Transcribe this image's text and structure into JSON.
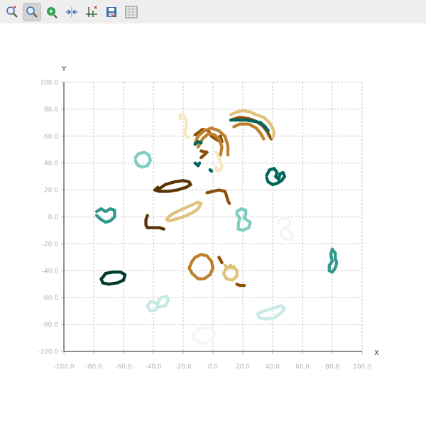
{
  "toolbar": {
    "tools": [
      {
        "icon": "zoom-select-icon",
        "active": false
      },
      {
        "icon": "zoom-icon",
        "active": true
      },
      {
        "icon": "pan-icon",
        "active": false
      },
      {
        "icon": "reset-zoom-icon",
        "active": false
      },
      {
        "icon": "axis-settings-icon",
        "active": false
      },
      {
        "icon": "save-icon",
        "active": false
      },
      {
        "icon": "data-table-icon",
        "active": false
      }
    ]
  },
  "chart_data": {
    "type": "scatter",
    "title": "",
    "xlabel": "X",
    "ylabel": "Y",
    "xlim": [
      -100,
      100
    ],
    "ylim": [
      -100,
      100
    ],
    "grid": true,
    "xticks": [
      "-100.0",
      "-80.0",
      "-60.0",
      "-40.0",
      "-20.0",
      "0.0",
      "20.0",
      "40.0",
      "60.0",
      "80.0",
      "100.0"
    ],
    "yticks": [
      "-100.0",
      "-80.0",
      "-60.0",
      "-40.0",
      "-20.0",
      "0.0",
      "20.0",
      "40.0",
      "60.0",
      "80.0",
      "100.0"
    ],
    "series": [
      {
        "color": "#5b3505",
        "points": [
          [
            -36,
            21
          ],
          [
            -32,
            24
          ],
          [
            -26,
            26
          ],
          [
            -20,
            27
          ],
          [
            -16,
            26
          ],
          [
            -15,
            24
          ],
          [
            -18,
            22
          ],
          [
            -24,
            20
          ],
          [
            -30,
            19
          ],
          [
            -36,
            19
          ],
          [
            -39,
            20
          ],
          [
            -37,
            22
          ]
        ]
      },
      {
        "color": "#5b3505",
        "points": [
          [
            -44,
            1
          ],
          [
            -45,
            -2
          ],
          [
            -45,
            -6
          ],
          [
            -44,
            -8
          ],
          [
            -40,
            -8
          ],
          [
            -36,
            -8
          ],
          [
            -33,
            -9
          ]
        ]
      },
      {
        "color": "#8c510a",
        "points": [
          [
            -4,
            18
          ],
          [
            0,
            19
          ],
          [
            4,
            20
          ],
          [
            8,
            19
          ],
          [
            9,
            16
          ],
          [
            10,
            12
          ],
          [
            11,
            10
          ]
        ]
      },
      {
        "color": "#8c510a",
        "points": [
          [
            -12,
            61
          ],
          [
            -7,
            65
          ],
          [
            -3,
            64
          ],
          [
            -1,
            60
          ],
          [
            3,
            57
          ],
          [
            6,
            56
          ],
          [
            5,
            60
          ],
          [
            2,
            58
          ]
        ]
      },
      {
        "color": "#8c510a",
        "points": [
          [
            12,
            72
          ],
          [
            18,
            74
          ],
          [
            24,
            73
          ],
          [
            29,
            71
          ],
          [
            33,
            68
          ],
          [
            36,
            64
          ],
          [
            38,
            60
          ],
          [
            39,
            58
          ]
        ]
      },
      {
        "color": "#8c510a",
        "points": [
          [
            -8,
            44
          ],
          [
            -6,
            46
          ],
          [
            -4,
            48
          ],
          [
            -8,
            49
          ]
        ]
      },
      {
        "color": "#8c510a",
        "points": [
          [
            4,
            -30
          ],
          [
            5,
            -32
          ],
          [
            6,
            -34
          ]
        ]
      },
      {
        "color": "#8c510a",
        "points": [
          [
            16,
            -50
          ],
          [
            18,
            -51
          ],
          [
            21,
            -51
          ]
        ]
      },
      {
        "color": "#bf812d",
        "points": [
          [
            -12,
            55
          ],
          [
            -10,
            60
          ],
          [
            -6,
            64
          ],
          [
            -1,
            66
          ],
          [
            4,
            64
          ],
          [
            8,
            60
          ],
          [
            10,
            53
          ],
          [
            10,
            46
          ]
        ]
      },
      {
        "color": "#bf812d",
        "points": [
          [
            -10,
            52
          ],
          [
            -7,
            58
          ],
          [
            -3,
            62
          ],
          [
            1,
            61
          ],
          [
            4,
            58
          ],
          [
            6,
            52
          ],
          [
            5,
            46
          ]
        ]
      },
      {
        "color": "#bf812d",
        "points": [
          [
            14,
            67
          ],
          [
            18,
            69
          ],
          [
            24,
            69
          ],
          [
            29,
            66
          ],
          [
            32,
            62
          ],
          [
            34,
            58
          ]
        ]
      },
      {
        "color": "#bf812d",
        "points": [
          [
            -14,
            -33
          ],
          [
            -12,
            -30
          ],
          [
            -8,
            -28
          ],
          [
            -4,
            -29
          ],
          [
            -1,
            -33
          ],
          [
            0,
            -38
          ],
          [
            -2,
            -43
          ],
          [
            -6,
            -46
          ],
          [
            -10,
            -46
          ],
          [
            -14,
            -42
          ],
          [
            -16,
            -38
          ],
          [
            -14,
            -33
          ]
        ]
      },
      {
        "color": "#dfc27d",
        "points": [
          [
            -30,
            -3
          ],
          [
            -26,
            -2
          ],
          [
            -20,
            0
          ],
          [
            -14,
            3
          ],
          [
            -10,
            6
          ],
          [
            -8,
            10
          ],
          [
            -10,
            11
          ],
          [
            -14,
            9
          ],
          [
            -20,
            6
          ],
          [
            -26,
            3
          ],
          [
            -30,
            0
          ],
          [
            -31,
            -2
          ]
        ]
      },
      {
        "color": "#dfc27d",
        "points": [
          [
            12,
            76
          ],
          [
            16,
            78
          ],
          [
            20,
            79
          ],
          [
            25,
            78
          ],
          [
            29,
            76
          ],
          [
            34,
            74
          ],
          [
            38,
            70
          ],
          [
            40,
            66
          ],
          [
            41,
            62
          ],
          [
            40,
            59
          ]
        ]
      },
      {
        "color": "#dfc27d",
        "points": [
          [
            8,
            -36
          ],
          [
            10,
            -38
          ],
          [
            14,
            -37
          ],
          [
            16,
            -40
          ],
          [
            16,
            -44
          ],
          [
            13,
            -47
          ],
          [
            9,
            -46
          ],
          [
            7,
            -42
          ],
          [
            9,
            -38
          ],
          [
            12,
            -36
          ],
          [
            13,
            -38
          ]
        ]
      },
      {
        "color": "#f6e8c3",
        "points": [
          [
            -22,
            73
          ],
          [
            -22,
            76
          ],
          [
            -20,
            76
          ],
          [
            -18,
            72
          ],
          [
            -18,
            67
          ],
          [
            -19,
            62
          ],
          [
            -17,
            59
          ]
        ]
      },
      {
        "color": "#f6e8c3",
        "points": [
          [
            2,
            48
          ],
          [
            4,
            44
          ],
          [
            6,
            38
          ],
          [
            5,
            35
          ],
          [
            3,
            34
          ],
          [
            2,
            37
          ]
        ]
      },
      {
        "color": "#f5f5f5",
        "points": [
          [
            44,
            -4
          ],
          [
            46,
            -1
          ],
          [
            50,
            -1
          ],
          [
            52,
            -3
          ],
          [
            51,
            -7
          ],
          [
            47,
            -9
          ],
          [
            45,
            -12
          ],
          [
            47,
            -15
          ],
          [
            50,
            -17
          ],
          [
            53,
            -16
          ],
          [
            53,
            -12
          ],
          [
            50,
            -10
          ]
        ]
      },
      {
        "color": "#f3f7f6",
        "points": [
          [
            -12,
            -85
          ],
          [
            -8,
            -82
          ],
          [
            -3,
            -82
          ],
          [
            0,
            -84
          ],
          [
            1,
            -87
          ],
          [
            -1,
            -91
          ],
          [
            -5,
            -94
          ],
          [
            -10,
            -93
          ],
          [
            -13,
            -91
          ],
          [
            -13,
            -87
          ]
        ]
      },
      {
        "color": "#c7eae5",
        "points": [
          [
            -42,
            -70
          ],
          [
            -44,
            -66
          ],
          [
            -42,
            -63
          ],
          [
            -38,
            -64
          ],
          [
            -36,
            -67
          ],
          [
            -32,
            -66
          ],
          [
            -30,
            -62
          ],
          [
            -31,
            -59
          ],
          [
            -35,
            -60
          ],
          [
            -37,
            -64
          ],
          [
            -38,
            -69
          ],
          [
            -42,
            -70
          ]
        ]
      },
      {
        "color": "#c7eae5",
        "points": [
          [
            30,
            -72
          ],
          [
            34,
            -70
          ],
          [
            40,
            -68
          ],
          [
            46,
            -66
          ],
          [
            48,
            -68
          ],
          [
            46,
            -71
          ],
          [
            41,
            -75
          ],
          [
            36,
            -76
          ],
          [
            31,
            -75
          ],
          [
            30,
            -72
          ]
        ]
      },
      {
        "color": "#80cdc1",
        "points": [
          [
            -52,
            44
          ],
          [
            -50,
            47
          ],
          [
            -46,
            48
          ],
          [
            -43,
            46
          ],
          [
            -42,
            42
          ],
          [
            -44,
            38
          ],
          [
            -48,
            37
          ],
          [
            -51,
            39
          ],
          [
            -52,
            42
          ]
        ]
      },
      {
        "color": "#80cdc1",
        "points": [
          [
            16,
            4
          ],
          [
            19,
            6
          ],
          [
            22,
            5
          ],
          [
            22,
            2
          ],
          [
            21,
            -1
          ],
          [
            25,
            -4
          ],
          [
            24,
            -8
          ],
          [
            20,
            -10
          ],
          [
            17,
            -9
          ],
          [
            17,
            -5
          ],
          [
            18,
            -1
          ],
          [
            16,
            2
          ]
        ]
      },
      {
        "color": "#35978f",
        "points": [
          [
            -78,
            4
          ],
          [
            -75,
            6
          ],
          [
            -72,
            4
          ],
          [
            -69,
            6
          ],
          [
            -66,
            5
          ],
          [
            -66,
            0
          ],
          [
            -69,
            -3
          ],
          [
            -72,
            -4
          ],
          [
            -75,
            -2
          ],
          [
            -78,
            1
          ]
        ]
      },
      {
        "color": "#35978f",
        "points": [
          [
            80,
            -24
          ],
          [
            82,
            -27
          ],
          [
            82,
            -31
          ],
          [
            83,
            -34
          ],
          [
            82,
            -38
          ],
          [
            80,
            -41
          ],
          [
            78,
            -40
          ],
          [
            78,
            -36
          ],
          [
            80,
            -33
          ],
          [
            79,
            -28
          ],
          [
            80,
            -24
          ]
        ]
      },
      {
        "color": "#01665e",
        "points": [
          [
            36,
            31
          ],
          [
            38,
            35
          ],
          [
            41,
            36
          ],
          [
            43,
            33
          ],
          [
            42,
            30
          ],
          [
            44,
            28
          ],
          [
            45,
            32
          ],
          [
            47,
            33
          ],
          [
            48,
            30
          ],
          [
            46,
            27
          ],
          [
            43,
            25
          ],
          [
            40,
            24
          ],
          [
            37,
            26
          ],
          [
            36,
            29
          ]
        ]
      },
      {
        "color": "#01665e",
        "points": [
          [
            12,
            72
          ],
          [
            16,
            72
          ],
          [
            22,
            72
          ],
          [
            28,
            71
          ],
          [
            32,
            70
          ],
          [
            35,
            67
          ],
          [
            37,
            64
          ]
        ]
      },
      {
        "color": "#01665e",
        "points": [
          [
            -12,
            54
          ],
          [
            -10,
            56
          ],
          [
            -8,
            55
          ]
        ]
      },
      {
        "color": "#01665e",
        "points": [
          [
            -12,
            40
          ],
          [
            -10,
            38
          ],
          [
            -9,
            40
          ]
        ]
      },
      {
        "color": "#01665e",
        "points": [
          [
            -2,
            35
          ],
          [
            -1,
            34
          ]
        ]
      },
      {
        "color": "#003c30",
        "points": [
          [
            -74,
            -45
          ],
          [
            -72,
            -42
          ],
          [
            -67,
            -41
          ],
          [
            -62,
            -41
          ],
          [
            -59,
            -43
          ],
          [
            -60,
            -47
          ],
          [
            -64,
            -49
          ],
          [
            -70,
            -50
          ],
          [
            -74,
            -49
          ],
          [
            -75,
            -46
          ]
        ]
      }
    ]
  }
}
